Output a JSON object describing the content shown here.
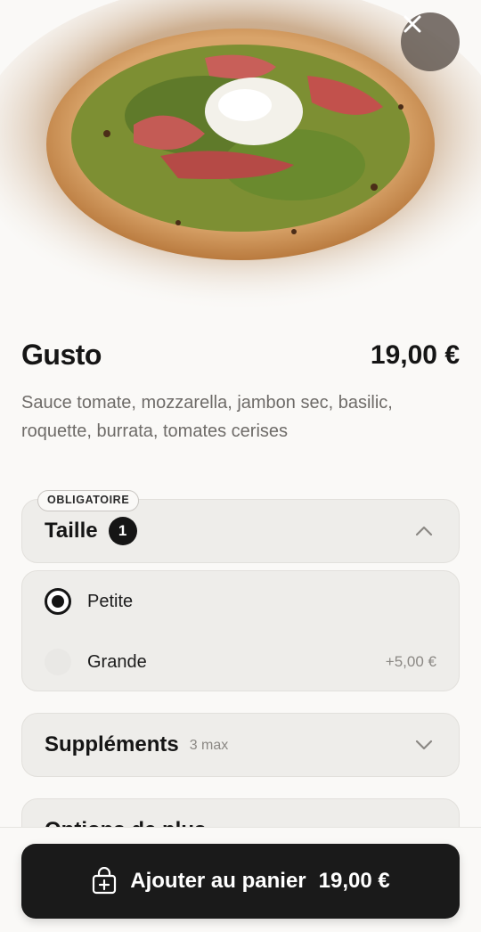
{
  "product": {
    "name": "Gusto",
    "price": "19,00 €",
    "description": "Sauce tomate, mozzarella, jambon sec, basilic, roquette, burrata, tomates cerises",
    "image_subject": "pizza"
  },
  "size_section": {
    "badge": "OBLIGATOIRE",
    "title": "Taille",
    "count": "1",
    "expanded": true,
    "options": [
      {
        "label": "Petite",
        "extra": "",
        "selected": true
      },
      {
        "label": "Grande",
        "extra": "+5,00 €",
        "selected": false
      }
    ]
  },
  "supplements_section": {
    "title": "Suppléments",
    "hint": "3 max",
    "expanded": false
  },
  "next_section": {
    "title": "Options de plus"
  },
  "cart_button": {
    "label": "Ajouter au panier",
    "price": "19,00 €"
  },
  "icons": {
    "close": "close-icon",
    "chevron_up": "chevron-up-icon",
    "chevron_down": "chevron-down-icon",
    "bag": "shopping-bag-plus-icon"
  },
  "colors": {
    "background": "#faf9f7",
    "card": "#eeedea",
    "primary": "#1a1a1a"
  }
}
